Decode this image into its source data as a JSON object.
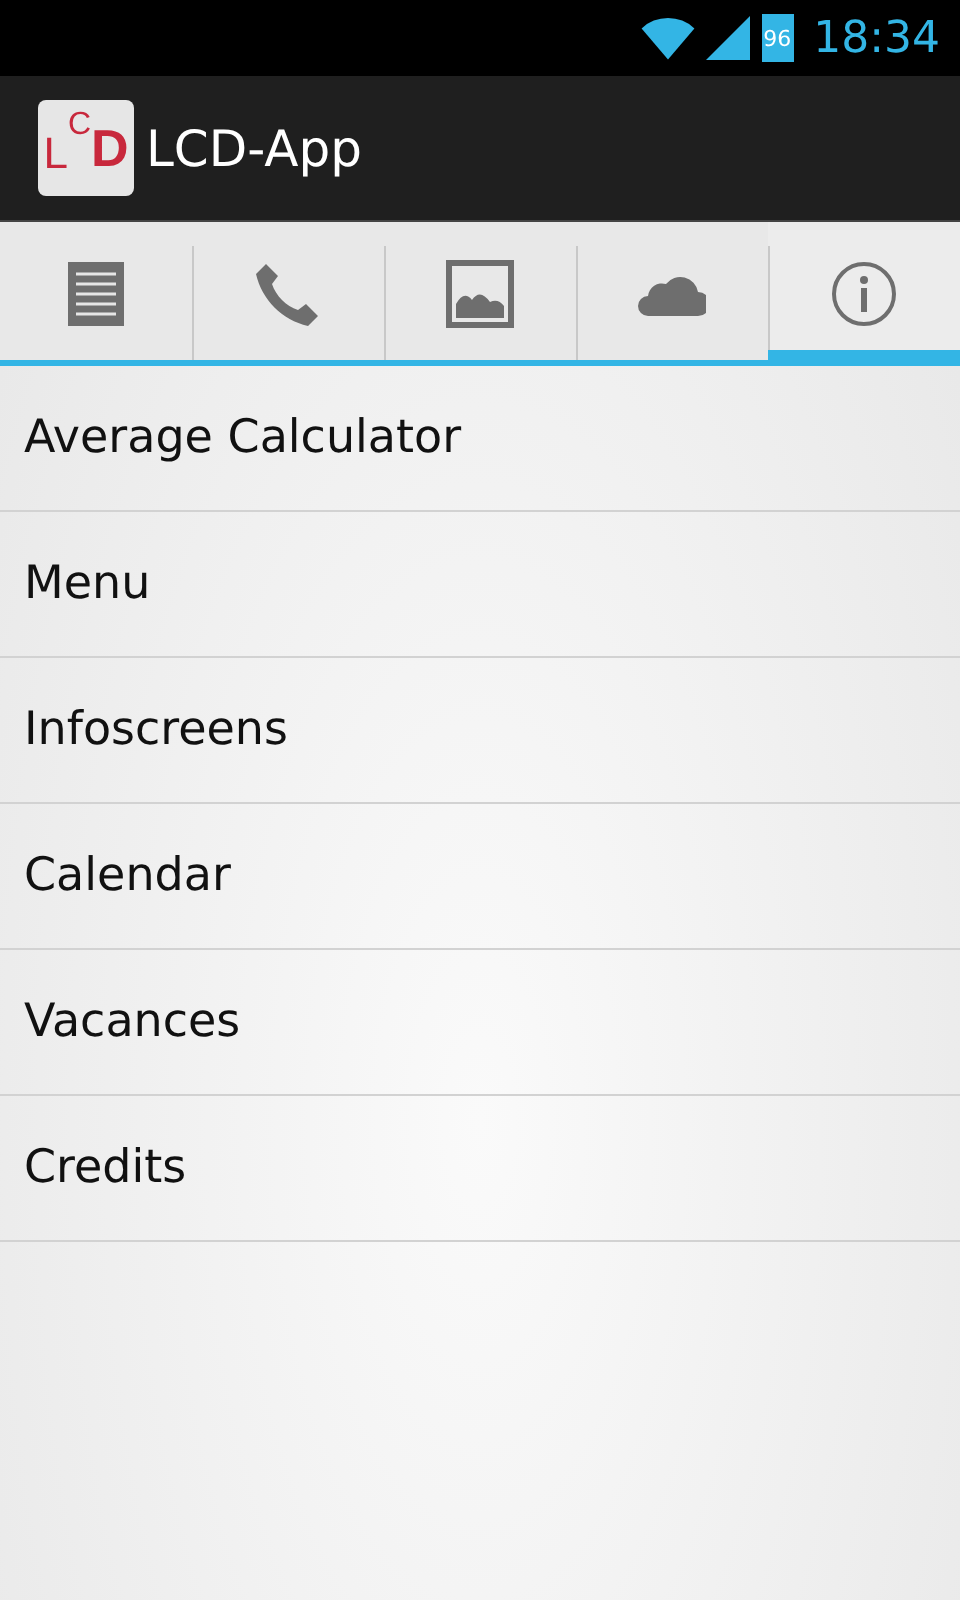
{
  "status_bar": {
    "battery": "96",
    "time": "18:34"
  },
  "action_bar": {
    "logo": "LCD",
    "title": "LCD-App"
  },
  "tabs": [
    {
      "kind": "list",
      "selected": false
    },
    {
      "kind": "phone",
      "selected": false
    },
    {
      "kind": "image",
      "selected": false
    },
    {
      "kind": "cloud",
      "selected": false
    },
    {
      "kind": "info",
      "selected": true
    }
  ],
  "items": [
    "Average Calculator",
    "Menu",
    "Infoscreens",
    "Calendar",
    "Vacances",
    "Credits"
  ]
}
